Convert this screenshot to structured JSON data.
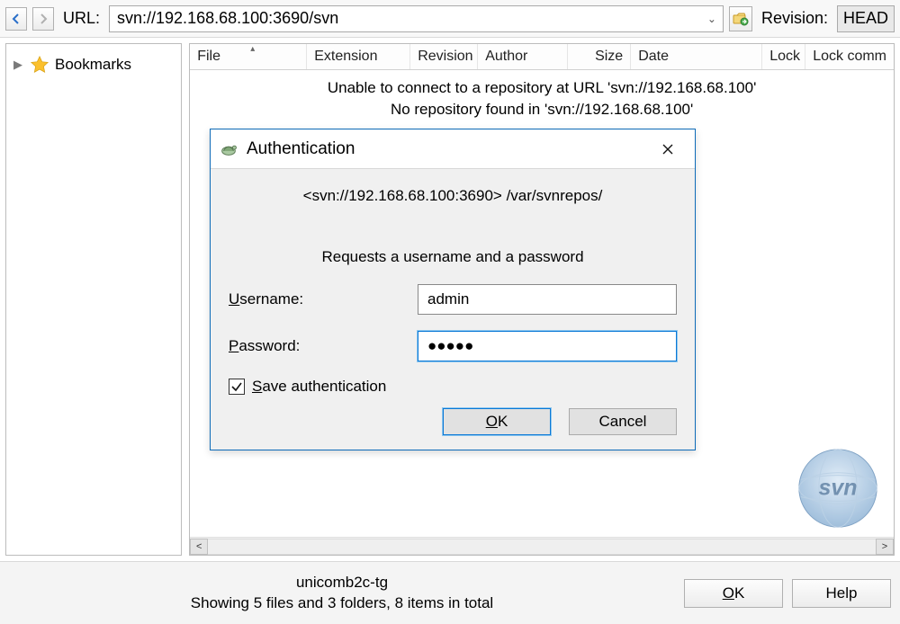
{
  "toolbar": {
    "url_label": "URL:",
    "url_value": "svn://192.168.68.100:3690/svn",
    "revision_label": "Revision:",
    "head_label": "HEAD"
  },
  "sidebar": {
    "bookmarks_label": "Bookmarks"
  },
  "columns": {
    "file": "File",
    "extension": "Extension",
    "revision": "Revision",
    "author": "Author",
    "size": "Size",
    "date": "Date",
    "lock": "Lock",
    "lock_comment": "Lock comm"
  },
  "messages": {
    "line1": "Unable to connect to a repository at URL 'svn://192.168.68.100'",
    "line2": "No repository found in 'svn://192.168.68.100'"
  },
  "dialog": {
    "title": "Authentication",
    "repo_line": "<svn://192.168.68.100:3690> /var/svnrepos/",
    "prompt": "Requests a username and a password",
    "username_label_pre": "U",
    "username_label_post": "sername:",
    "password_label_pre": "P",
    "password_label_post": "assword:",
    "username_value": "admin",
    "password_display": "●●●●●",
    "save_auth_pre": "S",
    "save_auth_post": "ave authentication",
    "save_auth_checked": true,
    "ok_pre": "O",
    "ok_post": "K",
    "cancel": "Cancel"
  },
  "status": {
    "hostname": "unicomb2c-tg",
    "summary": "Showing 5 files and 3 folders, 8 items in total",
    "ok_pre": "O",
    "ok_post": "K",
    "help": "Help"
  }
}
